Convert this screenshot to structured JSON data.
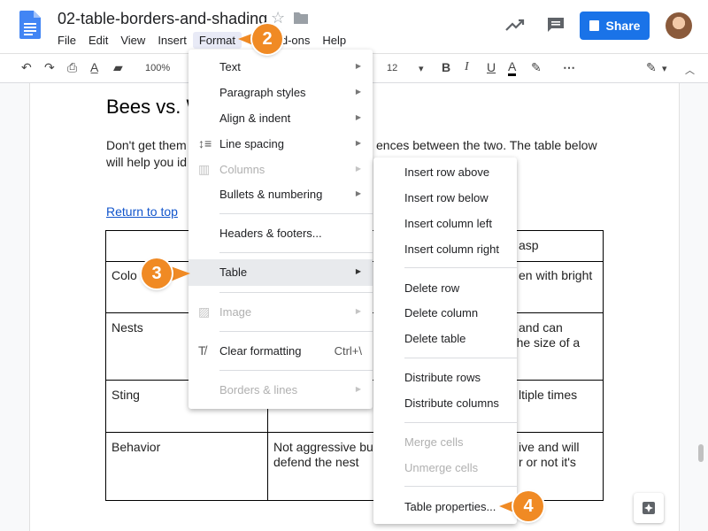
{
  "doc": {
    "title": "02-table-borders-and-shading",
    "heading": "Bees vs. W",
    "paragraph_line1_left": "Don't get them",
    "paragraph_line1_right": "ences between the two. The table below",
    "paragraph_line2_left": "will help you id",
    "link": "Return to top"
  },
  "menubar": {
    "items": [
      "File",
      "Edit",
      "View",
      "Insert",
      "Format",
      "T",
      "Add-ons",
      "Help"
    ]
  },
  "header": {
    "share_label": "Share"
  },
  "toolbar": {
    "zoom": "100%",
    "font_size": "12"
  },
  "table": {
    "header_right": "asp",
    "rows": [
      {
        "label": "Colo",
        "right": "en with bright"
      },
      {
        "label": "Nests",
        "right_line1": "and can",
        "right_line2": "e the size of a"
      },
      {
        "label": "Sting",
        "right": "ltiple times"
      },
      {
        "label": "Behavior",
        "middle_line1": "Not aggressive bu",
        "middle_line2": "defend the nest",
        "right_line1": "ive and will",
        "right_line2": "r or not it's"
      }
    ]
  },
  "format_menu": {
    "items": [
      {
        "label": "Text",
        "submenu": true
      },
      {
        "label": "Paragraph styles",
        "submenu": true
      },
      {
        "label": "Align & indent",
        "submenu": true
      },
      {
        "label": "Line spacing",
        "submenu": true
      },
      {
        "label": "Columns",
        "submenu": true,
        "disabled": true
      },
      {
        "label": "Bullets & numbering",
        "submenu": true
      },
      {
        "label": "Headers & footers..."
      },
      {
        "label": "Table",
        "submenu": true,
        "highlighted": true
      },
      {
        "label": "Image",
        "submenu": true,
        "disabled": true
      },
      {
        "label": "Clear formatting",
        "shortcut": "Ctrl+\\"
      },
      {
        "label": "Borders & lines",
        "submenu": true,
        "disabled": true
      }
    ]
  },
  "table_menu": {
    "items": [
      {
        "label": "Insert row above"
      },
      {
        "label": "Insert row below"
      },
      {
        "label": "Insert column left"
      },
      {
        "label": "Insert column right"
      },
      {
        "label": "Delete row"
      },
      {
        "label": "Delete column"
      },
      {
        "label": "Delete table"
      },
      {
        "label": "Distribute rows"
      },
      {
        "label": "Distribute columns"
      },
      {
        "label": "Merge cells",
        "disabled": true
      },
      {
        "label": "Unmerge cells",
        "disabled": true
      },
      {
        "label": "Table properties..."
      }
    ]
  },
  "callouts": {
    "c2": "2",
    "c3": "3",
    "c4": "4"
  },
  "colors": {
    "accent": "#1a73e8",
    "callout": "#f08a24"
  }
}
